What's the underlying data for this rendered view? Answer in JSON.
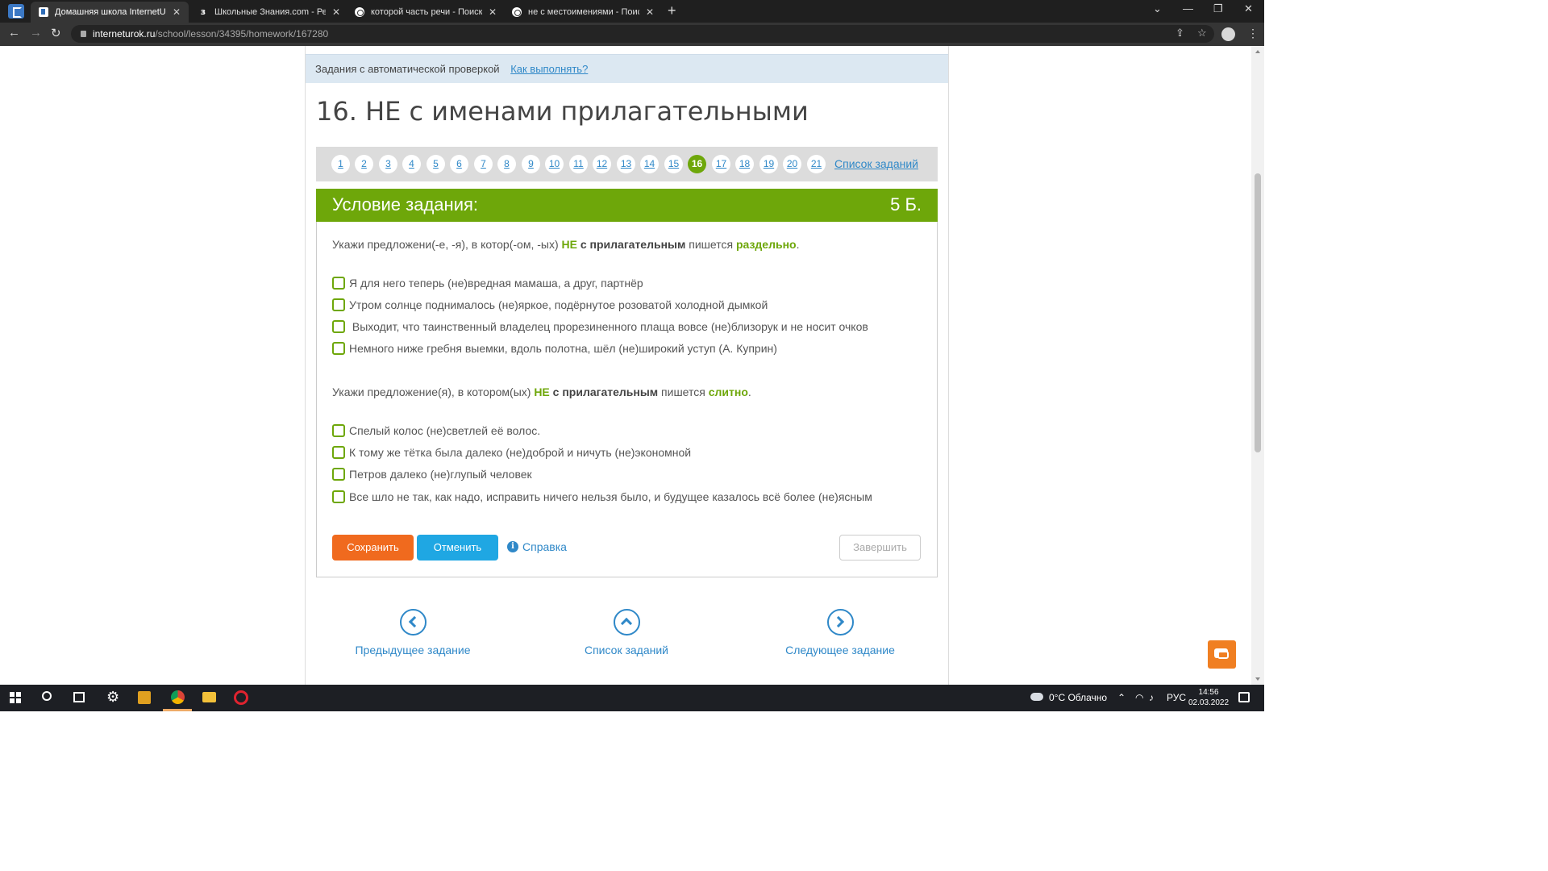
{
  "browser": {
    "tabs": [
      {
        "title": "Домашняя школа InternetUrok.ru",
        "icon": "internetUrok-favicon"
      },
      {
        "title": "Школьные Знания.com - Решае",
        "icon": "znanija-favicon"
      },
      {
        "title": "которой часть речи - Поиск в Google",
        "icon": "google-favicon"
      },
      {
        "title": "не с местоимениями - Поиск в Google",
        "icon": "google-favicon"
      }
    ],
    "url_domain": "interneturok.ru",
    "url_path": "/school/lesson/34395/homework/167280"
  },
  "page": {
    "auto_check_text": "Задания с автоматической проверкой",
    "how_to_link": "Как выполнять?",
    "title": "16. НЕ с именами прилагательными",
    "pager": {
      "numbers": [
        "1",
        "2",
        "3",
        "4",
        "5",
        "6",
        "7",
        "8",
        "9",
        "10",
        "11",
        "12",
        "13",
        "14",
        "15",
        "16",
        "17",
        "18",
        "19",
        "20",
        "21"
      ],
      "active": "16",
      "list_link": "Список заданий"
    },
    "task": {
      "header": "Условие задания:",
      "score": "5 Б.",
      "q1": {
        "prefix": "Укажи предложени(-е, -я), в котор(-ом, -ых) ",
        "ne": "НЕ",
        "bold": " с прилагательным",
        "mid": " пишется ",
        "key": "раздельно",
        "end": "."
      },
      "q1_options": [
        "Я для него теперь (не)вредная мамаша, а друг, партнёр",
        "Утром солнце поднималось (не)яркое, подёрнутое розоватой холодной дымкой",
        " Выходит, что таинственный владелец прорезиненного плаща вовсе (не)близорук и не носит очков",
        "Немного ниже гребня выемки, вдоль полотна, шёл (не)широкий уступ (А. Куприн)"
      ],
      "q2": {
        "prefix": "Укажи предложение(я), в котором(ых) ",
        "ne": "НЕ",
        "bold": " с прилагательным",
        "mid": " пишется ",
        "key": "слитно",
        "end": "."
      },
      "q2_options": [
        "Спелый колос (не)светлей её волос.",
        "К тому же тётка была далеко (не)доброй и ничуть (не)экономной",
        "Петров далеко (не)глупый человек",
        "Все шло не так, как надо, исправить ничего нельзя было, и будущее казалось всё более (не)ясным"
      ],
      "save_label": "Сохранить",
      "cancel_label": "Отменить",
      "help_label": "Справка",
      "finish_label": "Завершить"
    },
    "nav": {
      "prev": "Предыдущее задание",
      "list": "Список заданий",
      "next": "Следующее задание"
    }
  },
  "taskbar": {
    "weather": "0°C Облачно",
    "lang": "РУС",
    "time": "14:56",
    "date": "02.03.2022"
  },
  "colors": {
    "green": "#6ea70a",
    "orange": "#f06a1e",
    "blue": "#1fa7e3",
    "link": "#2f88c8"
  }
}
